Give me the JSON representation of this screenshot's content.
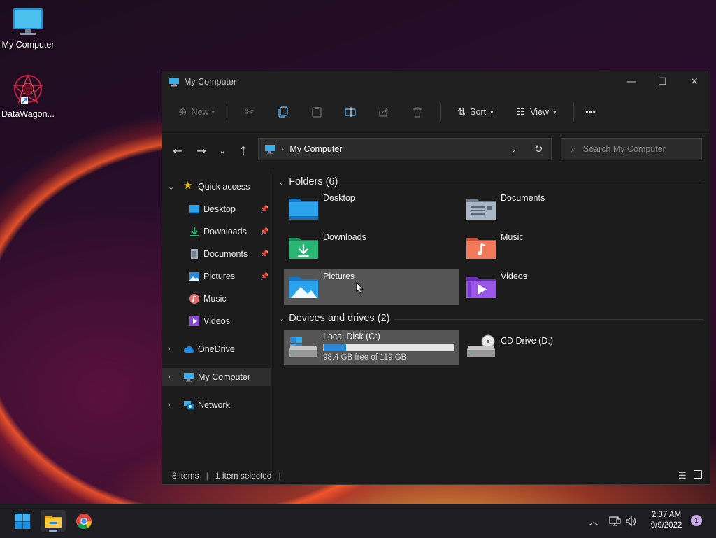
{
  "desktop": {
    "icons": [
      {
        "label": "My Computer"
      },
      {
        "label": "DataWagon..."
      }
    ]
  },
  "window": {
    "title": "My Computer",
    "toolbar": {
      "new_label": "New",
      "sort_label": "Sort",
      "view_label": "View",
      "more_label": "•••"
    },
    "address": {
      "path": "My Computer",
      "search_placeholder": "Search My Computer"
    },
    "sidebar": {
      "quick_access": "Quick access",
      "items": [
        {
          "label": "Desktop",
          "pinned": true
        },
        {
          "label": "Downloads",
          "pinned": true
        },
        {
          "label": "Documents",
          "pinned": true
        },
        {
          "label": "Pictures",
          "pinned": true
        },
        {
          "label": "Music",
          "pinned": false
        },
        {
          "label": "Videos",
          "pinned": false
        }
      ],
      "onedrive": "OneDrive",
      "my_computer": "My Computer",
      "network": "Network"
    },
    "content": {
      "folders_header": "Folders (6)",
      "folders": [
        {
          "name": "Desktop"
        },
        {
          "name": "Documents"
        },
        {
          "name": "Downloads"
        },
        {
          "name": "Music"
        },
        {
          "name": "Pictures"
        },
        {
          "name": "Videos"
        }
      ],
      "drives_header": "Devices and drives (2)",
      "drives": [
        {
          "name": "Local Disk (C:)",
          "free_text": "98.4 GB free of 119 GB",
          "used_fraction": 0.17
        },
        {
          "name": "CD Drive (D:)"
        }
      ]
    },
    "status": {
      "items": "8 items",
      "selected": "1 item selected"
    }
  },
  "taskbar": {
    "time": "2:37 AM",
    "date": "9/9/2022",
    "notifications": "1"
  },
  "colors": {
    "accent": "#2a8ad8",
    "selection": "#555555"
  }
}
